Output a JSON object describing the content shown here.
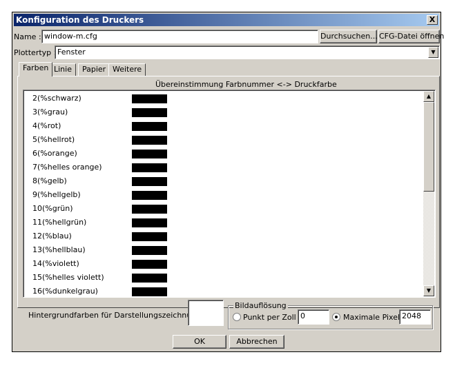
{
  "window": {
    "title": "Konfiguration des Druckers",
    "close_label": "X"
  },
  "name_row": {
    "label": "Name :",
    "value": "window-m.cfg",
    "browse_button": "Durchsuchen...",
    "open_cfg_button": "CFG-Datei öffnen"
  },
  "plotter_row": {
    "label": "Plottertyp >",
    "value": "Fenster",
    "dropdown_glyph": "▼"
  },
  "tabs": [
    {
      "label": "Farben",
      "active": true
    },
    {
      "label": "Linie"
    },
    {
      "label": "Papier"
    },
    {
      "label": "Weitere"
    }
  ],
  "colors_panel": {
    "header": "Übereinstimmung Farbnummer <-> Druckfarbe",
    "rows": [
      {
        "label": "2(%schwarz)",
        "color": "#000000"
      },
      {
        "label": "3(%grau)",
        "color": "#000000"
      },
      {
        "label": "4(%rot)",
        "color": "#000000"
      },
      {
        "label": "5(%hellrot)",
        "color": "#000000"
      },
      {
        "label": "6(%orange)",
        "color": "#000000"
      },
      {
        "label": "7(%helles orange)",
        "color": "#000000"
      },
      {
        "label": "8(%gelb)",
        "color": "#000000"
      },
      {
        "label": "9(%hellgelb)",
        "color": "#000000"
      },
      {
        "label": "10(%grün)",
        "color": "#000000"
      },
      {
        "label": "11(%hellgrün)",
        "color": "#000000"
      },
      {
        "label": "12(%blau)",
        "color": "#000000"
      },
      {
        "label": "13(%hellblau)",
        "color": "#000000"
      },
      {
        "label": "14(%violett)",
        "color": "#000000"
      },
      {
        "label": "15(%helles violett)",
        "color": "#000000"
      },
      {
        "label": "16(%dunkelgrau)",
        "color": "#000000"
      }
    ],
    "scroll_up_glyph": "▲",
    "scroll_down_glyph": "▼"
  },
  "background": {
    "label": "Hintergrundfarben für Darstellungszeichnungen",
    "color": "#ffffff"
  },
  "resolution": {
    "group_title": "Bildauflösung",
    "dpi_label": "Punkt per Zoll",
    "dpi_value": "0",
    "dpi_selected": false,
    "max_label": "Maximale Pixel",
    "max_value": "2048",
    "max_selected": true
  },
  "buttons": {
    "ok": "OK",
    "cancel": "Abbrechen"
  }
}
